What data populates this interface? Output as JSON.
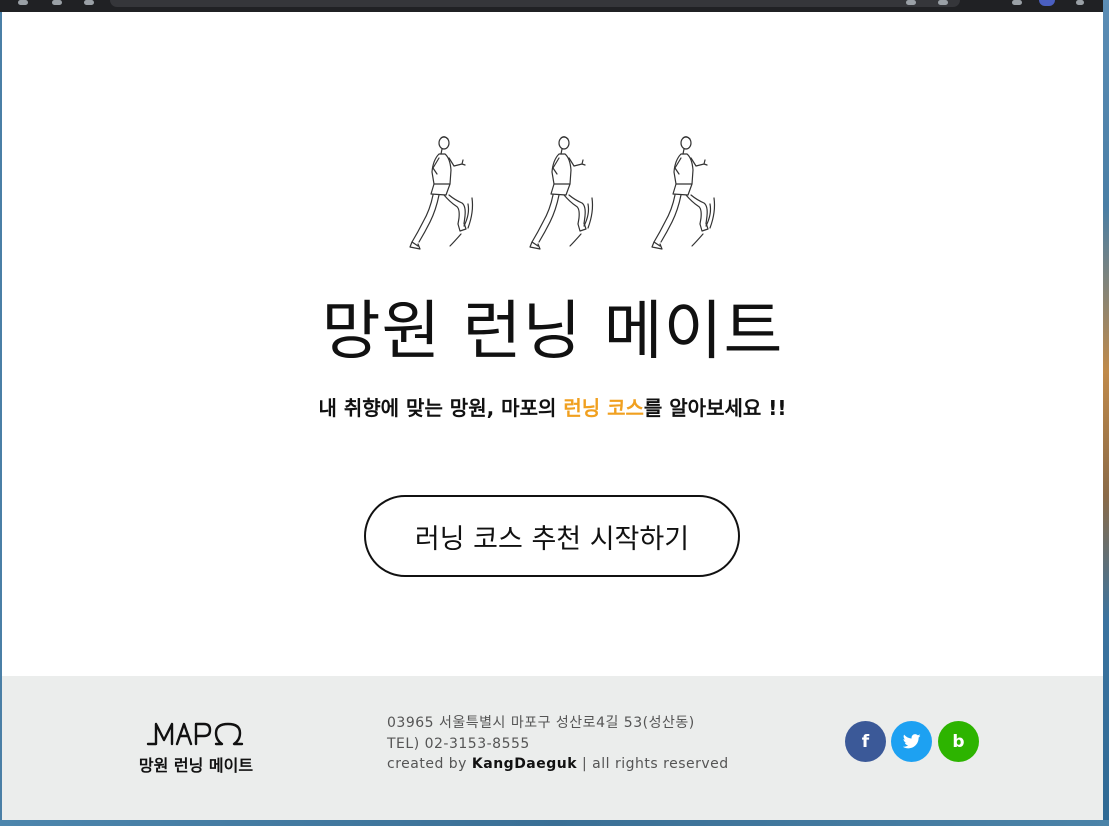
{
  "page": {
    "title": "망원 런닝 메이트",
    "subtitle_before": "내 취향에 맞는 망원, 마포의 ",
    "subtitle_highlight": "런닝 코스",
    "subtitle_after": "를 알아보세요 !!",
    "cta_label": "러닝 코스 추천 시작하기",
    "runner_count": 3
  },
  "footer": {
    "logo_mark": "MAPO",
    "logo_text": "망원 런닝 메이트",
    "address": "03965 서울특별시 마포구 성산로4길 53(성산동)",
    "tel": "TEL) 02-3153-8555",
    "credit_prefix": "created by ",
    "credit_author": "KangDaeguk",
    "credit_suffix": " | all rights reserved",
    "social": [
      {
        "name": "facebook",
        "glyph": "f",
        "color": "#3b5998"
      },
      {
        "name": "twitter",
        "glyph": "t",
        "color": "#1da1f2"
      },
      {
        "name": "blog",
        "glyph": "b",
        "color": "#2db400"
      }
    ]
  },
  "colors": {
    "highlight": "#f0a020",
    "footer_bg": "#ebedec",
    "text": "#111111"
  },
  "icons": {
    "runner": "running-man-sketch-icon",
    "facebook": "facebook-icon",
    "twitter": "twitter-bird-icon",
    "blog": "blog-b-icon"
  }
}
